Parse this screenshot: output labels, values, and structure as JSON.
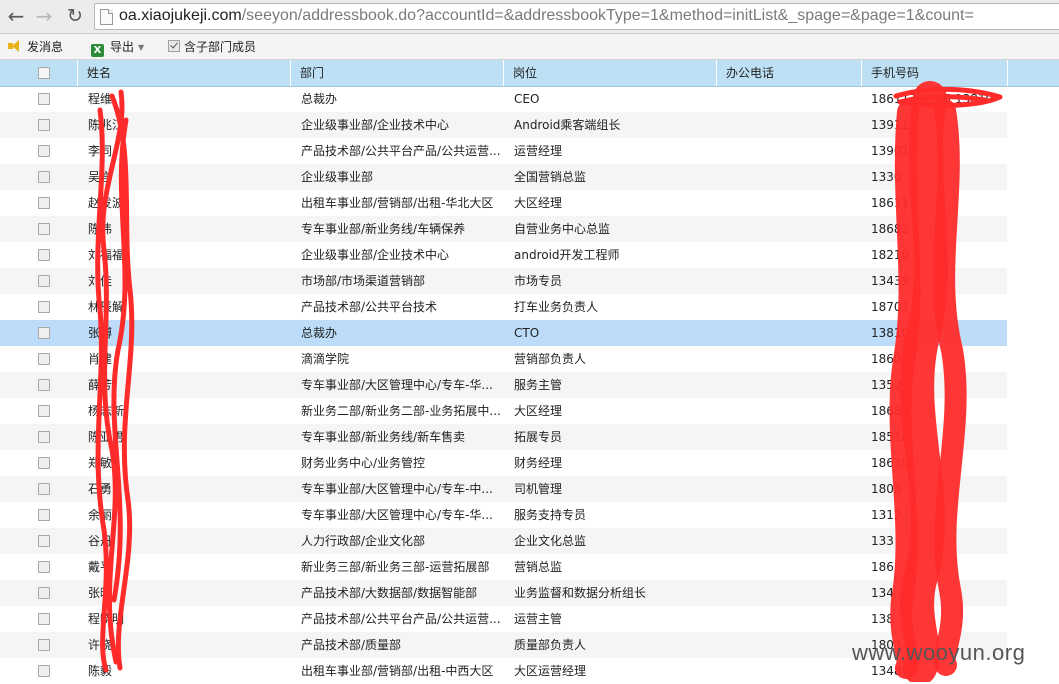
{
  "browser": {
    "back_icon": "arrow-left-icon",
    "forward_icon": "arrow-right-icon",
    "reload_icon": "reload-icon",
    "url_host": "oa.xiaojukeji.com",
    "url_path": "/seeyon/addressbook.do?accountId=&addressbookType=1&method=initList&_spage=&page=1&count="
  },
  "toolbar": {
    "send_label": "发消息",
    "export_label": "导出",
    "include_sub_label": "含子部门成员",
    "include_sub_checked": true
  },
  "table": {
    "headers": [
      "姓名",
      "部门",
      "岗位",
      "办公电话",
      "手机号码"
    ],
    "rows": [
      {
        "name": "程维",
        "dept": "总裁办",
        "post": "CEO",
        "tel": "",
        "mobile": "186117966 5 13810"
      },
      {
        "name": "陈兆江",
        "dept": "企业级事业部/企业技术中心",
        "post": "Android乘客端组长",
        "tel": "",
        "mobile": "13911"
      },
      {
        "name": "李同",
        "dept": "产品技术部/公共平台产品/公共运营...",
        "post": "运营经理",
        "tel": "",
        "mobile": "13901"
      },
      {
        "name": "吴言",
        "dept": "企业级事业部",
        "post": "全国营销总监",
        "tel": "",
        "mobile": "1330"
      },
      {
        "name": "赵发波",
        "dept": "出租车事业部/营销部/出租-华北大区",
        "post": "大区经理",
        "tel": "",
        "mobile": "18611"
      },
      {
        "name": "陈伟",
        "dept": "专车事业部/新业务线/车辆保养",
        "post": "自营业务中心总监",
        "tel": "",
        "mobile": "18682"
      },
      {
        "name": "刘福福",
        "dept": "企业级事业部/企业技术中心",
        "post": "android开发工程师",
        "tel": "",
        "mobile": "18210"
      },
      {
        "name": "刘佳",
        "dept": "市场部/市场渠道营销部",
        "post": "市场专员",
        "tel": "",
        "mobile": "13439"
      },
      {
        "name": "林辰解",
        "dept": "产品技术部/公共平台技术",
        "post": "打车业务负责人",
        "tel": "",
        "mobile": "18701"
      },
      {
        "name": "张博",
        "dept": "总裁办",
        "post": "CTO",
        "tel": "",
        "mobile": "13810"
      },
      {
        "name": "肖建",
        "dept": "滴滴学院",
        "post": "营销部负责人",
        "tel": "",
        "mobile": "1860"
      },
      {
        "name": "薛芳",
        "dept": "专车事业部/大区管理中心/专车-华...",
        "post": "服务主管",
        "tel": "",
        "mobile": "13521"
      },
      {
        "name": "杨志新",
        "dept": "新业务二部/新业务二部-业务拓展中...",
        "post": "大区经理",
        "tel": "",
        "mobile": "18682"
      },
      {
        "name": "陈亚男",
        "dept": "专车事业部/新业务线/新车售卖",
        "post": "拓展专员",
        "tel": "",
        "mobile": "18518"
      },
      {
        "name": "郑敏",
        "dept": "财务业务中心/业务管控",
        "post": "财务经理",
        "tel": "",
        "mobile": "18610"
      },
      {
        "name": "石勇",
        "dept": "专车事业部/大区管理中心/专车-中...",
        "post": "司机管理",
        "tel": "",
        "mobile": "1803"
      },
      {
        "name": "余丽",
        "dept": "专车事业部/大区管理中心/专车-华...",
        "post": "服务支持专员",
        "tel": "",
        "mobile": "1312"
      },
      {
        "name": "谷丹",
        "dept": "人力行政部/企业文化部",
        "post": "企业文化总监",
        "tel": "",
        "mobile": "133"
      },
      {
        "name": "戴平",
        "dept": "新业务三部/新业务三部-运营拓展部",
        "post": "营销总监",
        "tel": "",
        "mobile": "186"
      },
      {
        "name": "张晓",
        "dept": "产品技术部/大数据部/数据智能部",
        "post": "业务监督和数据分析组长",
        "tel": "",
        "mobile": "134"
      },
      {
        "name": "程晓明",
        "dept": "产品技术部/公共平台产品/公共运营...",
        "post": "运营主管",
        "tel": "",
        "mobile": "138"
      },
      {
        "name": "许晓",
        "dept": "产品技术部/质量部",
        "post": "质量部负责人",
        "tel": "",
        "mobile": "1803"
      },
      {
        "name": "陈毅",
        "dept": "出租车事业部/营销部/出租-中西大区",
        "post": "大区运营经理",
        "tel": "",
        "mobile": "1348"
      }
    ],
    "selected_index": 9
  },
  "watermark": "www.wooyun.org",
  "colors": {
    "header_bg": "#bde0f5",
    "selected_row": "#bcdcf9",
    "scribble": "#ff2b2b"
  }
}
